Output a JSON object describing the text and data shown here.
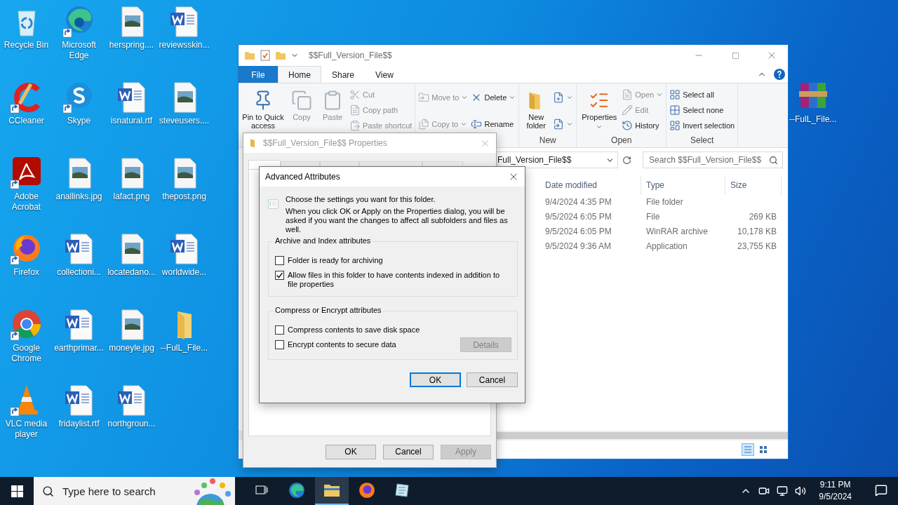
{
  "desktop": {
    "icons": [
      {
        "label": "Recycle Bin",
        "kind": "recycle-bin",
        "shortcut": false
      },
      {
        "label": "CCleaner",
        "kind": "ccleaner",
        "shortcut": true
      },
      {
        "label": "Adobe Acrobat",
        "kind": "pdf-app",
        "shortcut": true
      },
      {
        "label": "Firefox",
        "kind": "firefox",
        "shortcut": true
      },
      {
        "label": "Google Chrome",
        "kind": "chrome",
        "shortcut": true
      },
      {
        "label": "VLC media player",
        "kind": "vlc",
        "shortcut": true
      },
      {
        "label": "Microsoft Edge",
        "kind": "edge",
        "shortcut": true
      },
      {
        "label": "Skype",
        "kind": "skype",
        "shortcut": true
      },
      {
        "label": "anallinks.jpg",
        "kind": "image-file",
        "shortcut": false
      },
      {
        "label": "collectioni...",
        "kind": "word-file",
        "shortcut": false
      },
      {
        "label": "earthprimar...",
        "kind": "word-file",
        "shortcut": false
      },
      {
        "label": "fridaylist.rtf",
        "kind": "word-file",
        "shortcut": false
      },
      {
        "label": "herspring....",
        "kind": "image-file",
        "shortcut": false
      },
      {
        "label": "isnatural.rtf",
        "kind": "word-file",
        "shortcut": false
      },
      {
        "label": "lafact.png",
        "kind": "image-file",
        "shortcut": false
      },
      {
        "label": "locatedano...",
        "kind": "image-file",
        "shortcut": false
      },
      {
        "label": "moneyle.jpg",
        "kind": "image-file",
        "shortcut": false
      },
      {
        "label": "northgroun...",
        "kind": "word-file",
        "shortcut": false
      },
      {
        "label": "reviewsskin...",
        "kind": "word-file",
        "shortcut": false
      },
      {
        "label": "steveusers....",
        "kind": "image-file",
        "shortcut": false
      },
      {
        "label": "thepost.png",
        "kind": "image-file",
        "shortcut": false
      },
      {
        "label": "worldwide...",
        "kind": "word-file",
        "shortcut": false
      },
      {
        "label": "--FulL_File...",
        "kind": "folder",
        "shortcut": false
      }
    ],
    "side_icons": [
      {
        "label": "--FulL_File...",
        "kind": "archive",
        "shortcut": false
      }
    ]
  },
  "explorer": {
    "title": "$$Full_Version_File$$",
    "tabs": [
      {
        "label": "File",
        "kind": "file-menu",
        "selected": false
      },
      {
        "label": "Home",
        "kind": "tab",
        "selected": true
      },
      {
        "label": "Share",
        "kind": "tab",
        "selected": false
      },
      {
        "label": "View",
        "kind": "tab",
        "selected": false
      }
    ],
    "ribbon": {
      "groups": [
        {
          "items": [
            {
              "kind": "large",
              "label": "Pin to Quick access",
              "disabled": false,
              "dropdown": false
            },
            {
              "kind": "large",
              "label": "Copy",
              "disabled": true,
              "dropdown": false
            },
            {
              "kind": "large",
              "label": "Paste",
              "disabled": true,
              "dropdown": false
            },
            {
              "kind": "stack",
              "items": [
                {
                  "label": "Cut",
                  "disabled": true,
                  "dropdown": false
                },
                {
                  "label": "Copy path",
                  "disabled": true,
                  "dropdown": false
                },
                {
                  "label": "Paste shortcut",
                  "disabled": true,
                  "dropdown": false
                }
              ]
            }
          ]
        },
        {
          "items": [
            {
              "kind": "stack",
              "items": [
                {
                  "label": "Move to",
                  "disabled": true,
                  "dropdown": true
                },
                {
                  "label": "Copy to",
                  "disabled": true,
                  "dropdown": true
                }
              ]
            },
            {
              "kind": "stack",
              "items": [
                {
                  "label": "Delete",
                  "disabled": false,
                  "dropdown": true
                },
                {
                  "label": "Rename",
                  "disabled": false,
                  "dropdown": false
                }
              ]
            }
          ]
        },
        {
          "label": "New",
          "items": [
            {
              "kind": "large",
              "label": "New folder",
              "disabled": false,
              "dropdown": false
            },
            {
              "kind": "stack",
              "items": [
                {
                  "disabled": false,
                  "dropdown": true
                },
                {
                  "disabled": false,
                  "dropdown": true
                }
              ]
            }
          ]
        },
        {
          "label": "Open",
          "items": [
            {
              "kind": "large",
              "label": "Properties",
              "disabled": false,
              "dropdown": true
            },
            {
              "kind": "stack",
              "items": [
                {
                  "label": "Open",
                  "disabled": true,
                  "dropdown": true
                },
                {
                  "label": "Edit",
                  "disabled": true,
                  "dropdown": false
                },
                {
                  "label": "History",
                  "disabled": false,
                  "dropdown": false
                }
              ]
            }
          ]
        },
        {
          "label": "Select",
          "items": [
            {
              "kind": "stack",
              "items": [
                {
                  "label": "Select all",
                  "disabled": false,
                  "dropdown": false
                },
                {
                  "label": "Select none",
                  "disabled": false,
                  "dropdown": false
                },
                {
                  "label": "Invert selection",
                  "disabled": false,
                  "dropdown": false
                }
              ]
            }
          ]
        }
      ]
    },
    "address": "Full_Version_File$$",
    "search": {
      "placeholder": "Search $$Full_Version_File$$"
    },
    "columns": [
      "Date modified",
      "Type",
      "Size"
    ],
    "rows": [
      {
        "date": "9/4/2024 4:35 PM",
        "type": "File folder"
      },
      {
        "date": "9/5/2024 6:05 PM",
        "type": "File",
        "size": "269 KB"
      },
      {
        "date": "9/5/2024 6:05 PM",
        "type": "WinRAR archive",
        "size": "10,178 KB"
      },
      {
        "date": "9/5/2024 9:36 AM",
        "type": "Application",
        "size": "23,755 KB"
      }
    ]
  },
  "properties": {
    "title": "$$Full_Version_File$$ Properties",
    "tabs": [
      {
        "selected": true
      },
      {
        "selected": false
      },
      {
        "selected": false
      },
      {
        "selected": false
      },
      {
        "selected": false
      }
    ],
    "buttons": [
      {
        "label": "OK",
        "disabled": false
      },
      {
        "label": "Cancel",
        "disabled": false
      },
      {
        "label": "Apply",
        "disabled": true
      }
    ]
  },
  "advanced": {
    "title": "Advanced Attributes",
    "intro": "Choose the settings you want for this folder.",
    "note": "When you click OK or Apply on the Properties dialog, you will be asked if you want the changes to affect all subfolders and files as well.",
    "groups": [
      {
        "legend": "Archive and Index attributes",
        "options": [
          {
            "label": "Folder is ready for archiving",
            "checked": false
          },
          {
            "label": "Allow files in this folder to have contents indexed in addition to file properties",
            "checked": true
          }
        ]
      },
      {
        "legend": "Compress or Encrypt attributes",
        "options": [
          {
            "label": "Compress contents to save disk space",
            "checked": false
          },
          {
            "label": "Encrypt contents to secure data",
            "checked": false
          }
        ],
        "button": {
          "label": "Details",
          "disabled": true
        }
      }
    ],
    "buttons": [
      {
        "label": "OK",
        "default": true
      },
      {
        "label": "Cancel",
        "default": false
      }
    ]
  },
  "taskbar": {
    "search": {
      "placeholder": "Type here to search"
    },
    "apps": [
      {
        "kind": "task-view",
        "active": false
      },
      {
        "kind": "edge",
        "active": false
      },
      {
        "kind": "explorer",
        "active": true
      },
      {
        "kind": "firefox",
        "active": false
      },
      {
        "kind": "notepad",
        "active": false
      }
    ],
    "time": "9:11 PM",
    "date": "9/5/2024"
  }
}
